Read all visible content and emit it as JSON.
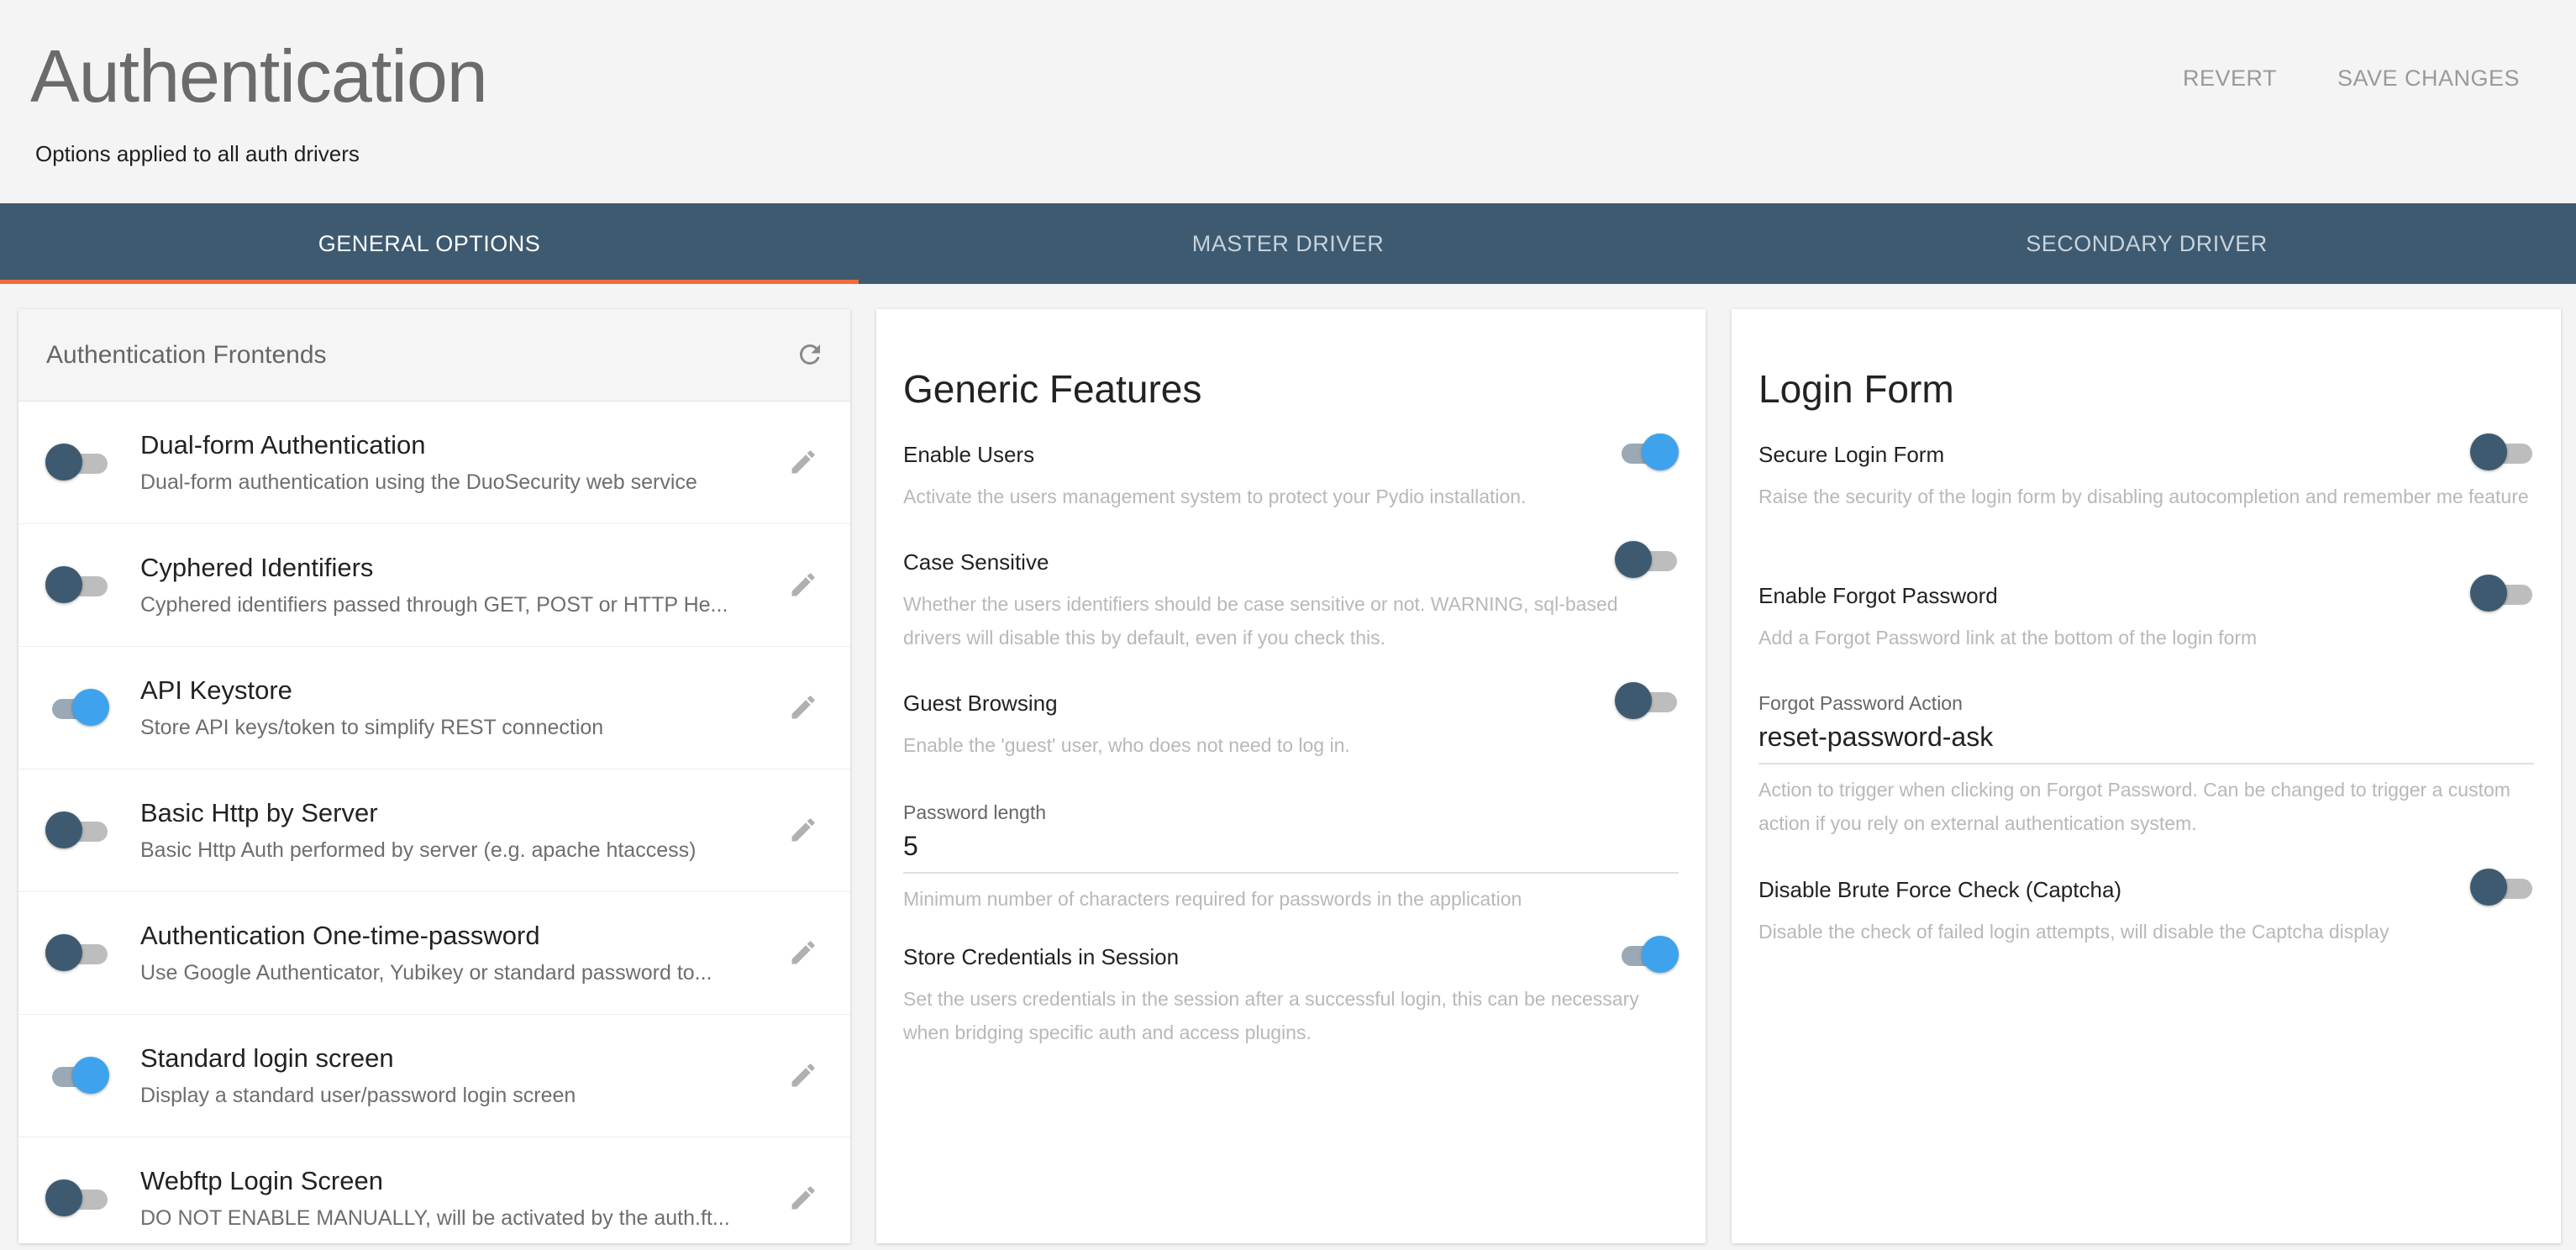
{
  "header": {
    "title": "Authentication",
    "subtitle": "Options applied to all auth drivers",
    "revert_label": "REVERT",
    "save_label": "SAVE CHANGES"
  },
  "tabs": [
    {
      "label": "GENERAL OPTIONS",
      "active": true
    },
    {
      "label": "MASTER DRIVER",
      "active": false
    },
    {
      "label": "SECONDARY DRIVER",
      "active": false
    }
  ],
  "frontends": {
    "title": "Authentication Frontends",
    "items": [
      {
        "name": "Dual-form Authentication",
        "desc": "Dual-form authentication using the DuoSecurity web service",
        "enabled": false
      },
      {
        "name": "Cyphered Identifiers",
        "desc": "Cyphered identifiers passed through GET, POST or HTTP He...",
        "enabled": false
      },
      {
        "name": "API Keystore",
        "desc": "Store API keys/token to simplify REST connection",
        "enabled": true
      },
      {
        "name": "Basic Http by Server",
        "desc": "Basic Http Auth performed by server (e.g. apache htaccess)",
        "enabled": false
      },
      {
        "name": "Authentication One-time-password",
        "desc": "Use Google Authenticator, Yubikey or standard password to...",
        "enabled": false
      },
      {
        "name": "Standard login screen",
        "desc": "Display a standard user/password login screen",
        "enabled": true
      },
      {
        "name": "Webftp Login Screen",
        "desc": "DO NOT ENABLE MANUALLY, will be activated by the auth.ft...",
        "enabled": false
      }
    ]
  },
  "generic": {
    "title": "Generic Features",
    "enable_users": {
      "label": "Enable Users",
      "help": "Activate the users management system to protect your Pydio installation.",
      "enabled": true
    },
    "case_sensitive": {
      "label": "Case Sensitive",
      "help": "Whether the users identifiers should be case sensitive or not. WARNING, sql-based drivers will disable this by default, even if you check this.",
      "enabled": false
    },
    "guest_browsing": {
      "label": "Guest Browsing",
      "help": "Enable the 'guest' user, who does not need to log in.",
      "enabled": false
    },
    "password_length": {
      "label": "Password length",
      "value": "5",
      "help": "Minimum number of characters required for passwords in the application"
    },
    "store_credentials": {
      "label": "Store Credentials in Session",
      "help": "Set the users credentials in the session after a successful login, this can be necessary when bridging specific auth and access plugins.",
      "enabled": true
    }
  },
  "login": {
    "title": "Login Form",
    "secure": {
      "label": "Secure Login Form",
      "help": "Raise the security of the login form by disabling autocompletion and remember me feature",
      "enabled": false
    },
    "forgot": {
      "label": "Enable Forgot Password",
      "help": "Add a Forgot Password link at the bottom of the login form",
      "enabled": false
    },
    "forgot_action": {
      "label": "Forgot Password Action",
      "value": "reset-password-ask",
      "help": "Action to trigger when clicking on Forgot Password. Can be changed to trigger a custom action if you rely on external authentication system."
    },
    "brute": {
      "label": "Disable Brute Force Check (Captcha)",
      "help": "Disable the check of failed login attempts, will disable the Captcha display",
      "enabled": false
    }
  },
  "icons": {
    "refresh": "refresh-icon",
    "edit": "pencil-icon"
  },
  "colors": {
    "tab_bar": "#3d5a70",
    "tab_indicator": "#f26b3a",
    "toggle_on": "#3ea3ec",
    "toggle_off_knob": "#3d5a70"
  }
}
